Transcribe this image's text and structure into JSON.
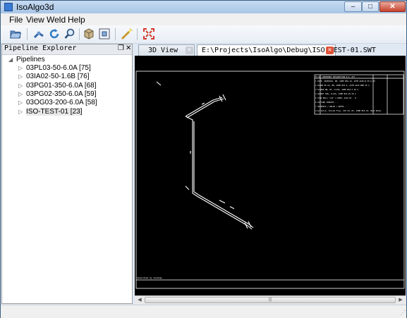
{
  "window": {
    "title": "IsoAlgo3d"
  },
  "window_controls": {
    "minimize": "–",
    "maximize": "□",
    "close": "✕"
  },
  "menu": [
    "File",
    "View",
    "Weld",
    "Help"
  ],
  "toolbar": {
    "icons": [
      "open-folder-icon",
      "pipe-icon",
      "refresh-icon",
      "zoom-icon",
      "cube-icon",
      "fit-view-icon",
      "magic-wand-icon",
      "explode-icon"
    ]
  },
  "explorer": {
    "title": "Pipeline Explorer",
    "float_glyph": "❐",
    "close_glyph": "✕",
    "root": "Pipelines",
    "items": [
      "03PL03-50-6.0A [75]",
      "03IA02-50-1.6B [76]",
      "03PG01-350-6.0A [68]",
      "03PG02-350-6.0A [59]",
      "03OG03-200-6.0A [58]",
      "ISO-TEST-01 [23]"
    ],
    "selected_index": 5
  },
  "tabs": [
    {
      "label": "3D View",
      "active": false,
      "close": "✕"
    },
    {
      "label": "E:\\Projects\\IsoAlgo\\Debug\\ISO-TEST-01.SWT",
      "active": true,
      "close": "✕"
    }
  ],
  "drawing": {
    "footer_note": "Generated by IsoAlgo",
    "bom_rows": [
      "PT NO  COMPONENT DESCRIPTION             N.S.  QTY",
      "1  PIPE, SEAMLESS, BE, ASME B36.10, ASTM A106-B  50   6.5M",
      "2  ELBOW 90 LR, BW, ASME B16.9, ASTM A234 WPB   50   4",
      "3  FLANGE WN, RF, CL150, ASME B16.5             50   2",
      "4  GASKET SPW, CL150, ASME B16.20                50   2",
      "5  STUD BOLT, 5/8\" x 85MM, A193 B7              -    8",
      "6  CUTTING LENGTHS                               -    -",
      "7  SUPPORTS / WELDS / NOTES                      -    -",
      "   Line Valve, Inside Flow, 150 LB, RF, ASME B16.34, Hand Wheel"
    ]
  },
  "colors": {
    "viewport": "#000000",
    "drawing_lines": "#ffffff",
    "tab_close": "#e0523a",
    "titlebar": "#b9d1ec"
  }
}
